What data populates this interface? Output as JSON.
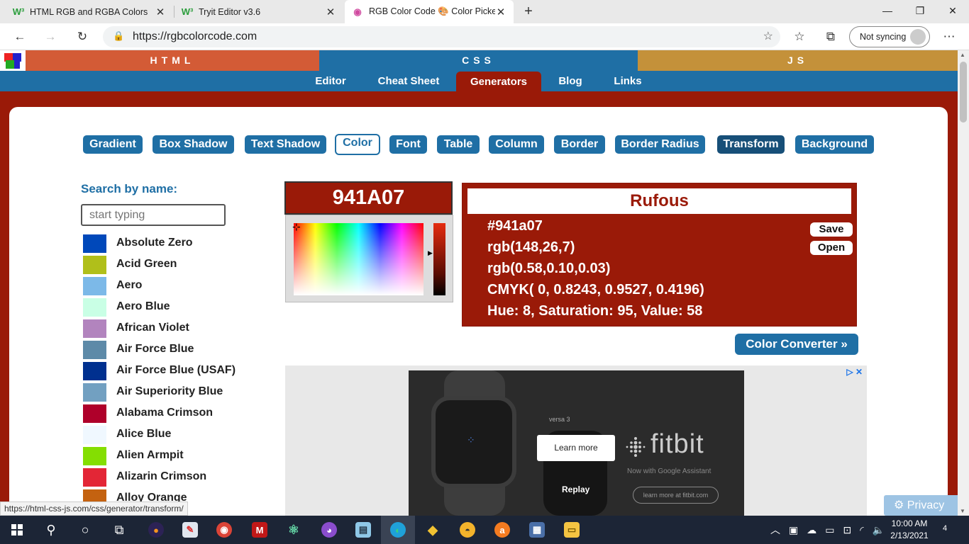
{
  "browser": {
    "tabs": [
      {
        "title": "HTML RGB and RGBA Colors",
        "favicon": "W³",
        "active": false
      },
      {
        "title": "Tryit Editor v3.6",
        "favicon": "W³",
        "active": false
      },
      {
        "title": "RGB Color Code 🎨 Color Picker",
        "favicon": "◉",
        "active": true
      }
    ],
    "address": "https://rgbcolorcode.com",
    "sync_label": "Not syncing",
    "status_url": "https://html-css-js.com/css/generator/transform/"
  },
  "site": {
    "top_nav": [
      "HTML",
      "CSS",
      "JS"
    ],
    "top_nav_colors": [
      "#d35b36",
      "#1f6fa5",
      "#c4913a"
    ],
    "sub_nav": [
      "Editor",
      "Cheat Sheet",
      "Generators",
      "Blog",
      "Links"
    ],
    "generators": [
      "Gradient",
      "Box Shadow",
      "Text Shadow",
      "Color",
      "Font",
      "Table",
      "Column",
      "Border",
      "Border Radius",
      "Transform",
      "Background"
    ],
    "selected_generator": "Color",
    "search_label": "Search by name:",
    "search_placeholder": "start typing",
    "colors": [
      {
        "name": "Absolute Zero",
        "hex": "#0048ba"
      },
      {
        "name": "Acid Green",
        "hex": "#b0bf1a"
      },
      {
        "name": "Aero",
        "hex": "#7cb9e8"
      },
      {
        "name": "Aero Blue",
        "hex": "#c9ffe5"
      },
      {
        "name": "African Violet",
        "hex": "#b284be"
      },
      {
        "name": "Air Force Blue",
        "hex": "#5d8aa8"
      },
      {
        "name": "Air Force Blue (USAF)",
        "hex": "#00308f"
      },
      {
        "name": "Air Superiority Blue",
        "hex": "#72a0c1"
      },
      {
        "name": "Alabama Crimson",
        "hex": "#af002a"
      },
      {
        "name": "Alice Blue",
        "hex": "#f0f8ff"
      },
      {
        "name": "Alien Armpit",
        "hex": "#84de02"
      },
      {
        "name": "Alizarin Crimson",
        "hex": "#e32636"
      },
      {
        "name": "Alloy Orange",
        "hex": "#c46210"
      }
    ],
    "hex_input": "941A07",
    "color_name": "Rufous",
    "color_info": [
      "#941a07",
      "rgb(148,26,7)",
      "rgb(0.58,0.10,0.03)",
      "CMYK( 0, 0.8243, 0.9527, 0.4196)",
      "Hue: 8, Saturation: 95, Value: 58"
    ],
    "save_label": "Save",
    "open_label": "Open",
    "converter_label": "Color Converter »",
    "privacy_label": "Privacy",
    "accent": "#9a1a08",
    "brand_blue": "#1f6fa5"
  },
  "ad": {
    "learn_more": "Learn more",
    "replay": "Replay",
    "brand": "fitbit",
    "tagline": "Now with Google Assistant",
    "link": "learn more at fitbit.com",
    "product": "versa 3"
  },
  "taskbar": {
    "time": "10:00 AM",
    "date": "2/13/2021",
    "notifications": "4"
  }
}
